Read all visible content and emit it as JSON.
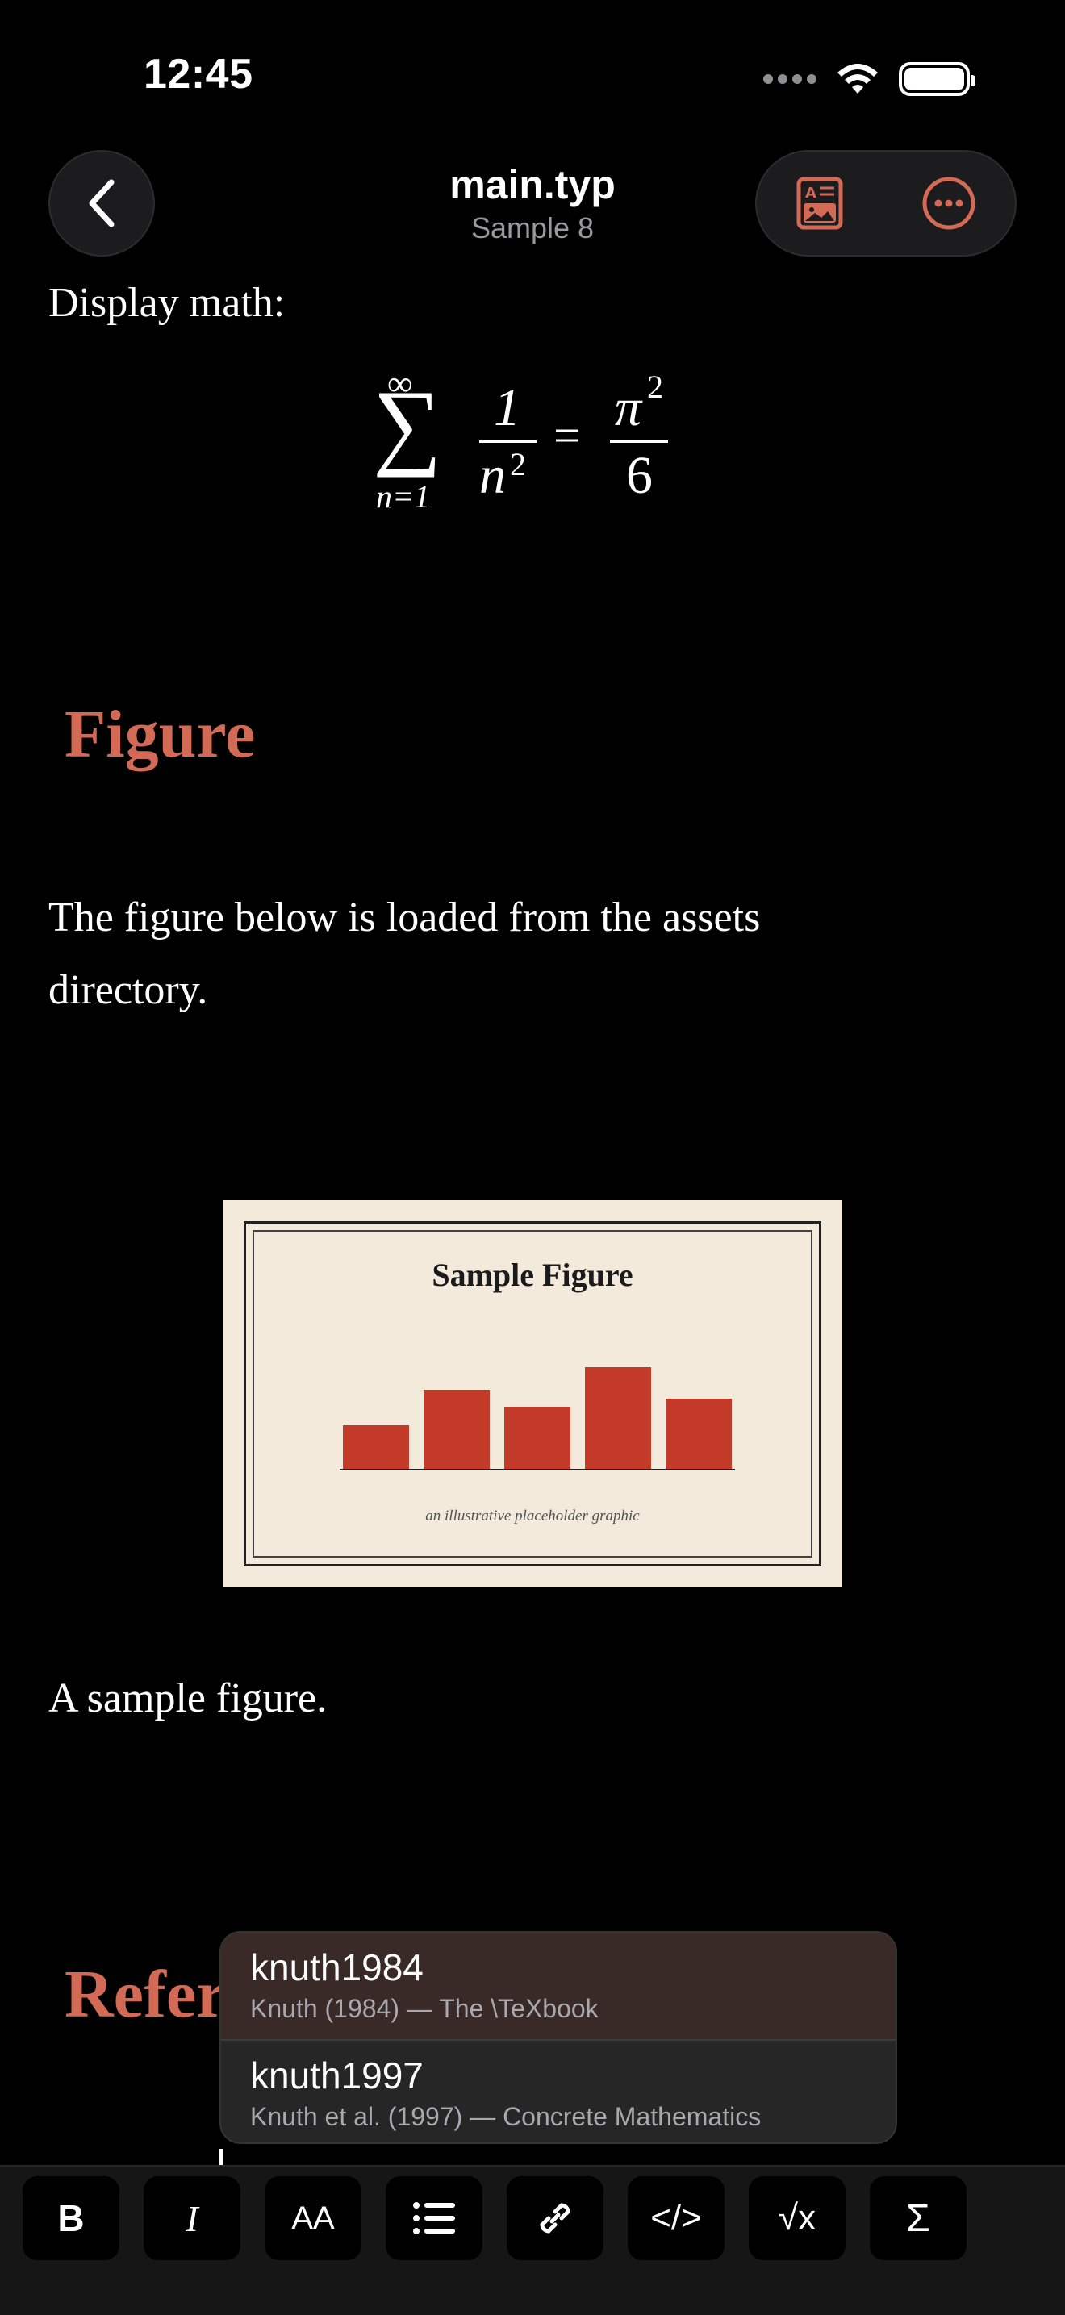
{
  "status": {
    "time": "12:45"
  },
  "nav": {
    "title": "main.typ",
    "subtitle": "Sample 8"
  },
  "colors": {
    "accent": "#d36a55",
    "bar": "#c33a28",
    "figure_bg": "#f3eadc"
  },
  "document": {
    "display_math_label": "Display math:",
    "math": {
      "sum_upper": "∞",
      "sum_lower": "n=1",
      "numerator_left": "1",
      "denominator_left": "n",
      "denominator_left_exp": "2",
      "equals": "=",
      "numerator_right": "π",
      "numerator_right_exp": "2",
      "denominator_right": "6"
    },
    "figure_heading": "Figure",
    "figure_paragraph_line1": "The figure below is loaded from the assets",
    "figure_paragraph_line2": "directory.",
    "figure": {
      "title": "Sample Figure",
      "caption_inner": "an illustrative placeholder graphic",
      "bar_values": [
        0.36,
        0.65,
        0.51,
        0.84,
        0.58
      ]
    },
    "figure_caption": "A sample figure.",
    "references_heading_visible": "Refer"
  },
  "autocomplete": [
    {
      "key": "knuth1984",
      "desc": "Knuth (1984) — The \\TeXbook"
    },
    {
      "key": "knuth1997",
      "desc": "Knuth et al. (1997) — Concrete Mathematics"
    }
  ],
  "toolbar": {
    "bold": "B",
    "italic": "I",
    "text_size": "AA",
    "list": "list-icon",
    "link": "link-icon",
    "code": "</>",
    "sqrt": "√x",
    "sum": "Σ"
  }
}
